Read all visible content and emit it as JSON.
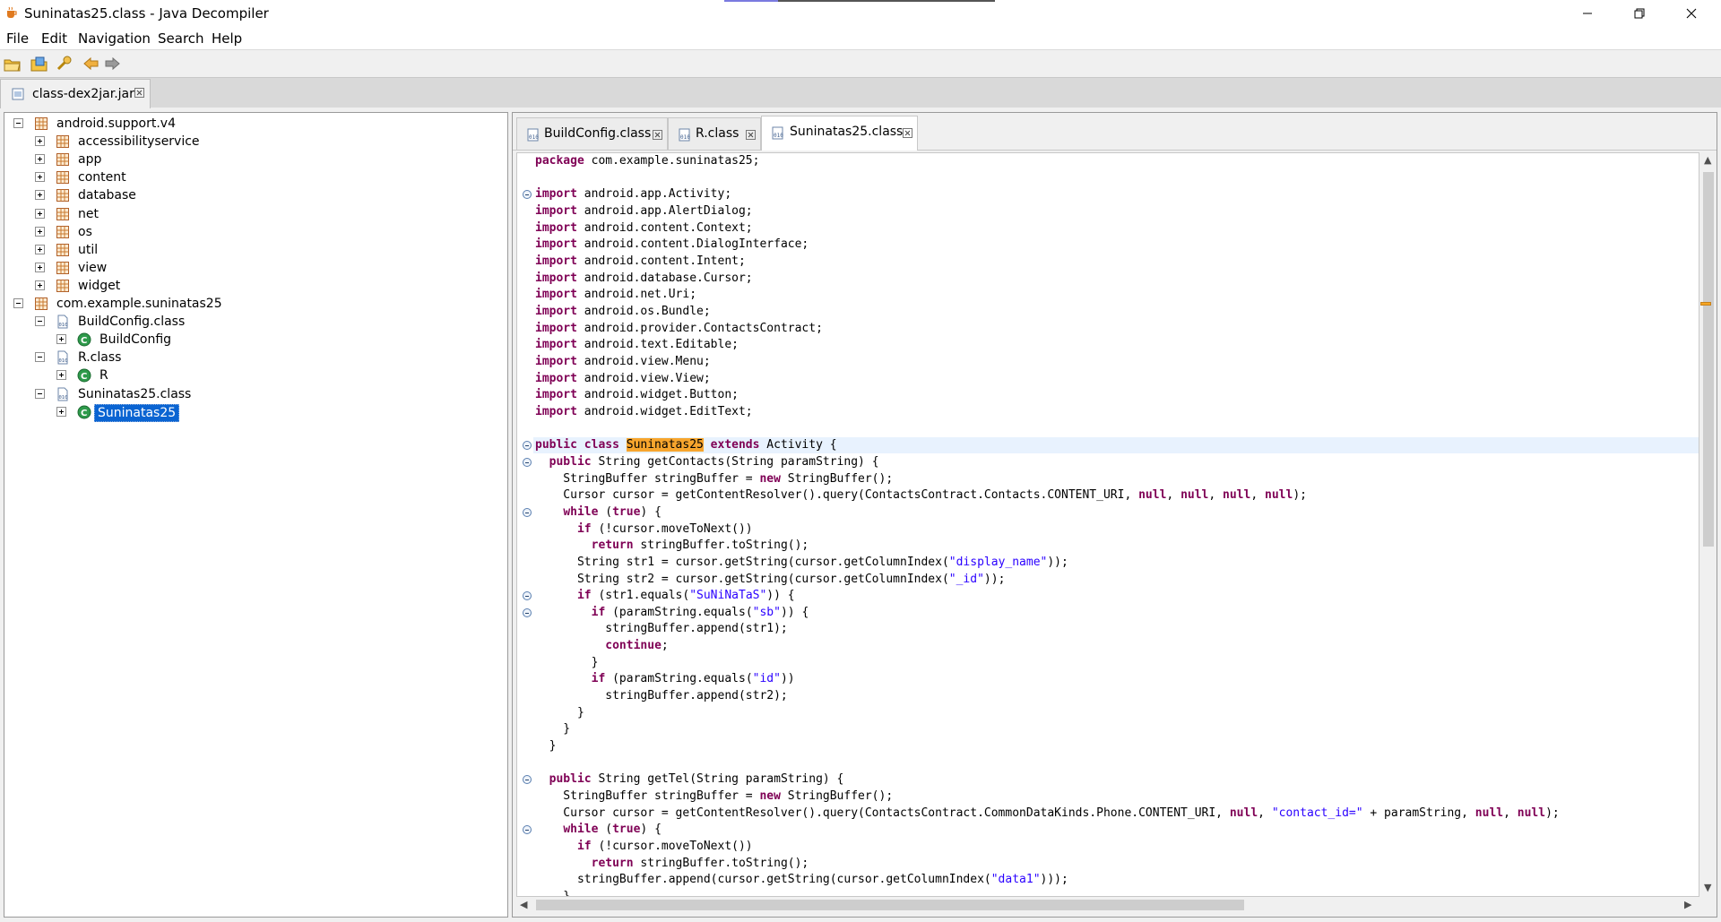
{
  "window": {
    "title": "Suninatas25.class - Java Decompiler",
    "minimize_icon": "minimize-icon",
    "maximize_icon": "restore-icon",
    "close_icon": "close-icon"
  },
  "menu": [
    "File",
    "Edit",
    "Navigation",
    "Search",
    "Help"
  ],
  "toolbar": [
    "open-file-icon",
    "open-type-icon",
    "open-type-hierarchy-icon",
    "back-arrow-icon",
    "forward-arrow-icon"
  ],
  "main_tab": {
    "label": "class-dex2jar.jar"
  },
  "tree": [
    {
      "label": "android.support.v4",
      "icon": "package-icon",
      "expand": "minus"
    },
    {
      "label": "accessibilityservice",
      "icon": "package-icon",
      "expand": "plus"
    },
    {
      "label": "app",
      "icon": "package-icon",
      "expand": "plus"
    },
    {
      "label": "content",
      "icon": "package-icon",
      "expand": "plus"
    },
    {
      "label": "database",
      "icon": "package-icon",
      "expand": "plus"
    },
    {
      "label": "net",
      "icon": "package-icon",
      "expand": "plus"
    },
    {
      "label": "os",
      "icon": "package-icon",
      "expand": "plus"
    },
    {
      "label": "util",
      "icon": "package-icon",
      "expand": "plus"
    },
    {
      "label": "view",
      "icon": "package-icon",
      "expand": "plus"
    },
    {
      "label": "widget",
      "icon": "package-icon",
      "expand": "plus"
    },
    {
      "label": "com.example.suninatas25",
      "icon": "package-icon",
      "expand": "minus"
    },
    {
      "label": "BuildConfig.class",
      "icon": "class-file-icon",
      "expand": "minus"
    },
    {
      "label": "BuildConfig",
      "icon": "class-icon",
      "expand": "plus"
    },
    {
      "label": "R.class",
      "icon": "class-file-icon",
      "expand": "minus"
    },
    {
      "label": "R",
      "icon": "class-icon",
      "expand": "plus"
    },
    {
      "label": "Suninatas25.class",
      "icon": "class-file-icon",
      "expand": "minus"
    },
    {
      "label": "Suninatas25",
      "icon": "class-icon",
      "expand": "plus",
      "selected": true
    }
  ],
  "editor_tabs": [
    {
      "label": "BuildConfig.class",
      "active": false
    },
    {
      "label": "R.class",
      "active": false
    },
    {
      "label": "Suninatas25.class",
      "active": true
    }
  ],
  "colors": {
    "keyword": "#7f0055",
    "string": "#2a00ff",
    "selection": "#0a64d2",
    "highlight": "#f7a52d"
  },
  "code_lines": [
    [
      [
        "kw",
        "package"
      ],
      [
        "t",
        " com.example.suninatas25;"
      ]
    ],
    [],
    [
      [
        "kw",
        "import"
      ],
      [
        "t",
        " android.app.Activity;"
      ]
    ],
    [
      [
        "kw",
        "import"
      ],
      [
        "t",
        " android.app.AlertDialog;"
      ]
    ],
    [
      [
        "kw",
        "import"
      ],
      [
        "t",
        " android.content.Context;"
      ]
    ],
    [
      [
        "kw",
        "import"
      ],
      [
        "t",
        " android.content.DialogInterface;"
      ]
    ],
    [
      [
        "kw",
        "import"
      ],
      [
        "t",
        " android.content.Intent;"
      ]
    ],
    [
      [
        "kw",
        "import"
      ],
      [
        "t",
        " android.database.Cursor;"
      ]
    ],
    [
      [
        "kw",
        "import"
      ],
      [
        "t",
        " android.net.Uri;"
      ]
    ],
    [
      [
        "kw",
        "import"
      ],
      [
        "t",
        " android.os.Bundle;"
      ]
    ],
    [
      [
        "kw",
        "import"
      ],
      [
        "t",
        " android.provider.ContactsContract;"
      ]
    ],
    [
      [
        "kw",
        "import"
      ],
      [
        "t",
        " android.text.Editable;"
      ]
    ],
    [
      [
        "kw",
        "import"
      ],
      [
        "t",
        " android.view.Menu;"
      ]
    ],
    [
      [
        "kw",
        "import"
      ],
      [
        "t",
        " android.view.View;"
      ]
    ],
    [
      [
        "kw",
        "import"
      ],
      [
        "t",
        " android.widget.Button;"
      ]
    ],
    [
      [
        "kw",
        "import"
      ],
      [
        "t",
        " android.widget.EditText;"
      ]
    ],
    [],
    [
      [
        "kw",
        "public class"
      ],
      [
        "t",
        " "
      ],
      [
        "mark",
        "Suninatas25"
      ],
      [
        "t",
        " "
      ],
      [
        "kw",
        "extends"
      ],
      [
        "t",
        " Activity {"
      ]
    ],
    [
      [
        "t",
        "  "
      ],
      [
        "kw",
        "public"
      ],
      [
        "t",
        " String getContacts(String paramString) {"
      ]
    ],
    [
      [
        "t",
        "    StringBuffer stringBuffer = "
      ],
      [
        "kw",
        "new"
      ],
      [
        "t",
        " StringBuffer();"
      ]
    ],
    [
      [
        "t",
        "    Cursor cursor = getContentResolver().query(ContactsContract.Contacts.CONTENT_URI, "
      ],
      [
        "kw",
        "null"
      ],
      [
        "t",
        ", "
      ],
      [
        "kw",
        "null"
      ],
      [
        "t",
        ", "
      ],
      [
        "kw",
        "null"
      ],
      [
        "t",
        ", "
      ],
      [
        "kw",
        "null"
      ],
      [
        "t",
        ");"
      ]
    ],
    [
      [
        "t",
        "    "
      ],
      [
        "kw",
        "while"
      ],
      [
        "t",
        " ("
      ],
      [
        "kw",
        "true"
      ],
      [
        "t",
        ") {"
      ]
    ],
    [
      [
        "t",
        "      "
      ],
      [
        "kw",
        "if"
      ],
      [
        "t",
        " (!cursor.moveToNext())"
      ]
    ],
    [
      [
        "t",
        "        "
      ],
      [
        "kw",
        "return"
      ],
      [
        "t",
        " stringBuffer.toString();"
      ]
    ],
    [
      [
        "t",
        "      String str1 = cursor.getString(cursor.getColumnIndex("
      ],
      [
        "str",
        "\"display_name\""
      ],
      [
        "t",
        "));"
      ]
    ],
    [
      [
        "t",
        "      String str2 = cursor.getString(cursor.getColumnIndex("
      ],
      [
        "str",
        "\"_id\""
      ],
      [
        "t",
        "));"
      ]
    ],
    [
      [
        "t",
        "      "
      ],
      [
        "kw",
        "if"
      ],
      [
        "t",
        " (str1.equals("
      ],
      [
        "str",
        "\"SuNiNaTaS\""
      ],
      [
        "t",
        ")) {"
      ]
    ],
    [
      [
        "t",
        "        "
      ],
      [
        "kw",
        "if"
      ],
      [
        "t",
        " (paramString.equals("
      ],
      [
        "str",
        "\"sb\""
      ],
      [
        "t",
        ")) {"
      ]
    ],
    [
      [
        "t",
        "          stringBuffer.append(str1);"
      ]
    ],
    [
      [
        "t",
        "          "
      ],
      [
        "kw",
        "continue"
      ],
      [
        "t",
        ";"
      ]
    ],
    [
      [
        "t",
        "        }"
      ]
    ],
    [
      [
        "t",
        "        "
      ],
      [
        "kw",
        "if"
      ],
      [
        "t",
        " (paramString.equals("
      ],
      [
        "str",
        "\"id\""
      ],
      [
        "t",
        "))"
      ]
    ],
    [
      [
        "t",
        "          stringBuffer.append(str2);"
      ]
    ],
    [
      [
        "t",
        "      }"
      ]
    ],
    [
      [
        "t",
        "    }"
      ]
    ],
    [
      [
        "t",
        "  }"
      ]
    ],
    [],
    [
      [
        "t",
        "  "
      ],
      [
        "kw",
        "public"
      ],
      [
        "t",
        " String getTel(String paramString) {"
      ]
    ],
    [
      [
        "t",
        "    StringBuffer stringBuffer = "
      ],
      [
        "kw",
        "new"
      ],
      [
        "t",
        " StringBuffer();"
      ]
    ],
    [
      [
        "t",
        "    Cursor cursor = getContentResolver().query(ContactsContract.CommonDataKinds.Phone.CONTENT_URI, "
      ],
      [
        "kw",
        "null"
      ],
      [
        "t",
        ", "
      ],
      [
        "str",
        "\"contact_id=\""
      ],
      [
        "t",
        " + paramString, "
      ],
      [
        "kw",
        "null"
      ],
      [
        "t",
        ", "
      ],
      [
        "kw",
        "null"
      ],
      [
        "t",
        ");"
      ]
    ],
    [
      [
        "t",
        "    "
      ],
      [
        "kw",
        "while"
      ],
      [
        "t",
        " ("
      ],
      [
        "kw",
        "true"
      ],
      [
        "t",
        ") {"
      ]
    ],
    [
      [
        "t",
        "      "
      ],
      [
        "kw",
        "if"
      ],
      [
        "t",
        " (!cursor.moveToNext())"
      ]
    ],
    [
      [
        "t",
        "        "
      ],
      [
        "kw",
        "return"
      ],
      [
        "t",
        " stringBuffer.toString();"
      ]
    ],
    [
      [
        "t",
        "      stringBuffer.append(cursor.getString(cursor.getColumnIndex("
      ],
      [
        "str",
        "\"data1\""
      ],
      [
        "t",
        ")));"
      ]
    ],
    [
      [
        "t",
        "    }"
      ]
    ]
  ],
  "fold_lines": [
    2,
    17,
    18,
    21,
    26,
    27,
    37,
    40
  ],
  "highlight_line": 17
}
